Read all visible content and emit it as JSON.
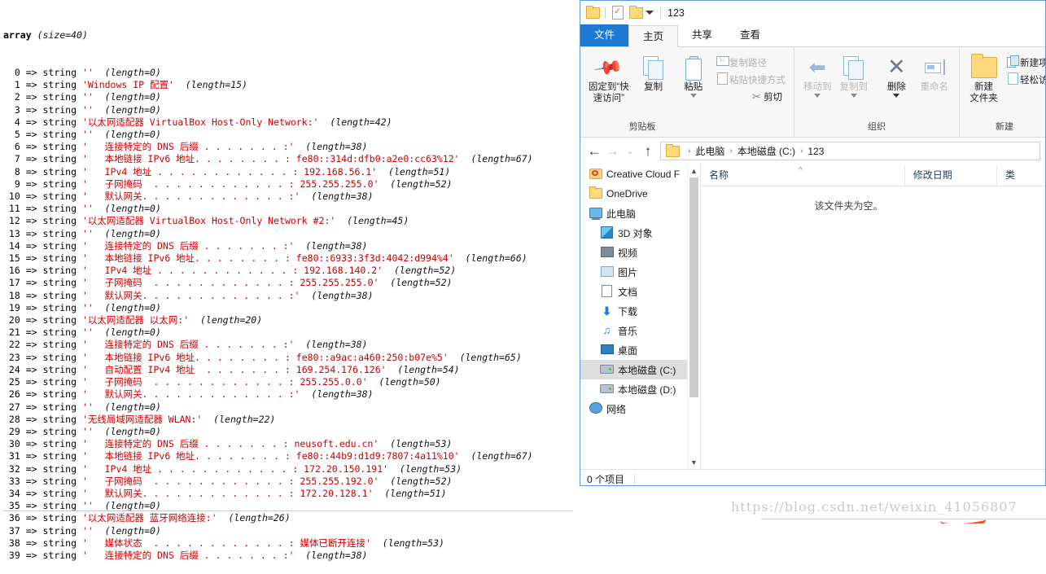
{
  "dump": {
    "header_type": "array",
    "header_meta": "(size=40)",
    "arrow": "=>",
    "type_label": "string",
    "rows": [
      {
        "idx": "0",
        "value": "",
        "len": "(length=0)"
      },
      {
        "idx": "1",
        "value": "Windows IP 配置",
        "len": "(length=15)"
      },
      {
        "idx": "2",
        "value": "",
        "len": "(length=0)"
      },
      {
        "idx": "3",
        "value": "",
        "len": "(length=0)"
      },
      {
        "idx": "4",
        "value": "以太网适配器 VirtualBox Host-Only Network:",
        "len": "(length=42)"
      },
      {
        "idx": "5",
        "value": "",
        "len": "(length=0)"
      },
      {
        "idx": "6",
        "value": "   连接特定的 DNS 后缀 . . . . . . . :",
        "len": "(length=38)"
      },
      {
        "idx": "7",
        "value": "   本地链接 IPv6 地址. . . . . . . . : fe80::314d:dfb0:a2e0:cc63%12",
        "len": "(length=67)"
      },
      {
        "idx": "8",
        "value": "   IPv4 地址 . . . . . . . . . . . . : 192.168.56.1",
        "len": "(length=51)"
      },
      {
        "idx": "9",
        "value": "   子网掩码  . . . . . . . . . . . . : 255.255.255.0",
        "len": "(length=52)"
      },
      {
        "idx": "10",
        "value": "   默认网关. . . . . . . . . . . . . :",
        "len": "(length=38)"
      },
      {
        "idx": "11",
        "value": "",
        "len": "(length=0)"
      },
      {
        "idx": "12",
        "value": "以太网适配器 VirtualBox Host-Only Network #2:",
        "len": "(length=45)"
      },
      {
        "idx": "13",
        "value": "",
        "len": "(length=0)"
      },
      {
        "idx": "14",
        "value": "   连接特定的 DNS 后缀 . . . . . . . :",
        "len": "(length=38)"
      },
      {
        "idx": "15",
        "value": "   本地链接 IPv6 地址. . . . . . . . : fe80::6933:3f3d:4042:d994%4",
        "len": "(length=66)"
      },
      {
        "idx": "16",
        "value": "   IPv4 地址 . . . . . . . . . . . . : 192.168.140.2",
        "len": "(length=52)"
      },
      {
        "idx": "17",
        "value": "   子网掩码  . . . . . . . . . . . . : 255.255.255.0",
        "len": "(length=52)"
      },
      {
        "idx": "18",
        "value": "   默认网关. . . . . . . . . . . . . :",
        "len": "(length=38)"
      },
      {
        "idx": "19",
        "value": "",
        "len": "(length=0)"
      },
      {
        "idx": "20",
        "value": "以太网适配器 以太网:",
        "len": "(length=20)"
      },
      {
        "idx": "21",
        "value": "",
        "len": "(length=0)"
      },
      {
        "idx": "22",
        "value": "   连接特定的 DNS 后缀 . . . . . . . :",
        "len": "(length=38)"
      },
      {
        "idx": "23",
        "value": "   本地链接 IPv6 地址. . . . . . . . : fe80::a9ac:a460:250:b07e%5",
        "len": "(length=65)"
      },
      {
        "idx": "24",
        "value": "   自动配置 IPv4 地址  . . . . . . . : 169.254.176.126",
        "len": "(length=54)"
      },
      {
        "idx": "25",
        "value": "   子网掩码  . . . . . . . . . . . . : 255.255.0.0",
        "len": "(length=50)"
      },
      {
        "idx": "26",
        "value": "   默认网关. . . . . . . . . . . . . :",
        "len": "(length=38)"
      },
      {
        "idx": "27",
        "value": "",
        "len": "(length=0)"
      },
      {
        "idx": "28",
        "value": "无线局域网适配器 WLAN:",
        "len": "(length=22)"
      },
      {
        "idx": "29",
        "value": "",
        "len": "(length=0)"
      },
      {
        "idx": "30",
        "value": "   连接特定的 DNS 后缀 . . . . . . . : neusoft.edu.cn",
        "len": "(length=53)"
      },
      {
        "idx": "31",
        "value": "   本地链接 IPv6 地址. . . . . . . . : fe80::44b9:d1d9:7807:4a11%10",
        "len": "(length=67)"
      },
      {
        "idx": "32",
        "value": "   IPv4 地址 . . . . . . . . . . . . : 172.20.150.191",
        "len": "(length=53)"
      },
      {
        "idx": "33",
        "value": "   子网掩码  . . . . . . . . . . . . : 255.255.192.0",
        "len": "(length=52)"
      },
      {
        "idx": "34",
        "value": "   默认网关. . . . . . . . . . . . . : 172.20.128.1",
        "len": "(length=51)"
      },
      {
        "idx": "35",
        "value": "",
        "len": "(length=0)"
      },
      {
        "idx": "36",
        "value": "以太网适配器 蓝牙网络连接:",
        "len": "(length=26)"
      },
      {
        "idx": "37",
        "value": "",
        "len": "(length=0)"
      },
      {
        "idx": "38",
        "value": "   媒体状态  . . . . . . . . . . . . : 媒体已断开连接",
        "len": "(length=53)"
      },
      {
        "idx": "39",
        "value": "   连接特定的 DNS 后缀 . . . . . . . :",
        "len": "(length=38)"
      }
    ]
  },
  "explorer": {
    "title": "123",
    "quick_access": [
      {
        "name": "folder-icon"
      },
      {
        "name": "properties-icon"
      },
      {
        "name": "new-folder-icon"
      },
      {
        "name": "customize-caret-icon"
      }
    ],
    "tabs": [
      {
        "label": "文件",
        "kind": "file"
      },
      {
        "label": "主页",
        "kind": "active"
      },
      {
        "label": "共享",
        "kind": "normal"
      },
      {
        "label": "查看",
        "kind": "normal"
      }
    ],
    "ribbon": {
      "groups": [
        {
          "title": "剪贴板",
          "big": [
            {
              "label": "固定到“快\n速访问”",
              "line1": "固定到“快",
              "line2": "速访问”",
              "icon": "pin-icon",
              "dim": false
            },
            {
              "label": "复制",
              "line1": "复制",
              "line2": "",
              "icon": "copy-icon",
              "dim": false
            },
            {
              "label": "粘贴",
              "line1": "粘贴",
              "line2": "",
              "icon": "paste-icon",
              "dim": false
            }
          ],
          "small": [
            {
              "label": "复制路径",
              "icon": "copy-path-icon",
              "dim": true
            },
            {
              "label": "粘贴快捷方式",
              "icon": "paste-shortcut-icon",
              "dim": true
            },
            {
              "label": "剪切",
              "icon": "cut-icon",
              "dim": false
            }
          ]
        },
        {
          "title": "组织",
          "big": [
            {
              "label": "移动到",
              "line1": "移动到",
              "line2": "",
              "icon": "move-to-icon",
              "dim": true
            },
            {
              "label": "复制到",
              "line1": "复制到",
              "line2": "",
              "icon": "copy-to-icon",
              "dim": true
            },
            {
              "label": "删除",
              "line1": "删除",
              "line2": "",
              "icon": "delete-icon",
              "dim": false
            },
            {
              "label": "重命名",
              "line1": "重命名",
              "line2": "",
              "icon": "rename-icon",
              "dim": true
            }
          ],
          "small": []
        },
        {
          "title": "新建",
          "big": [
            {
              "label": "新建文件夹",
              "line1": "新建",
              "line2": "文件夹",
              "icon": "new-folder-icon",
              "dim": false
            }
          ],
          "small": [
            {
              "label": "新建项目",
              "icon": "new-item-icon",
              "dim": false
            },
            {
              "label": "轻松访问",
              "icon": "easy-access-icon",
              "dim": false
            }
          ]
        }
      ]
    },
    "address": {
      "back": "←",
      "forward": "→",
      "recent": "⌄",
      "up": "↑",
      "crumbs": [
        "此电脑",
        "本地磁盘 (C:)",
        "123"
      ],
      "separator": "›"
    },
    "nav_items": [
      {
        "label": "Creative Cloud F",
        "icon": "creative-cloud-icon",
        "level": 0,
        "selected": false
      },
      {
        "label": "OneDrive",
        "icon": "onedrive-icon",
        "level": 0,
        "selected": false
      },
      {
        "label": "此电脑",
        "icon": "this-pc-icon",
        "level": 0,
        "selected": false
      },
      {
        "label": "3D 对象",
        "icon": "3d-objects-icon",
        "level": 1,
        "selected": false
      },
      {
        "label": "视频",
        "icon": "videos-icon",
        "level": 1,
        "selected": false
      },
      {
        "label": "图片",
        "icon": "pictures-icon",
        "level": 1,
        "selected": false
      },
      {
        "label": "文档",
        "icon": "documents-icon",
        "level": 1,
        "selected": false
      },
      {
        "label": "下载",
        "icon": "downloads-icon",
        "level": 1,
        "selected": false
      },
      {
        "label": "音乐",
        "icon": "music-icon",
        "level": 1,
        "selected": false
      },
      {
        "label": "桌面",
        "icon": "desktop-icon",
        "level": 1,
        "selected": false
      },
      {
        "label": "本地磁盘 (C:)",
        "icon": "local-disk-c-icon",
        "level": 1,
        "selected": true
      },
      {
        "label": "本地磁盘 (D:)",
        "icon": "local-disk-d-icon",
        "level": 1,
        "selected": false
      },
      {
        "label": "网络",
        "icon": "network-icon",
        "level": 0,
        "selected": false
      }
    ],
    "columns": [
      {
        "label": "名称",
        "sorted": true
      },
      {
        "label": "修改日期",
        "sorted": false
      },
      {
        "label": "类",
        "sorted": false
      }
    ],
    "empty_message": "该文件夹为空。",
    "status": "0 个项目"
  },
  "watermark": {
    "text": "https://blog.csdn.net/weixin_41056807"
  },
  "colors": {
    "accent": "#1e7ad4",
    "string_value": "#cc0000",
    "window_border": "#5b9bd5",
    "ribbon_bg": "#f7f7f7"
  }
}
